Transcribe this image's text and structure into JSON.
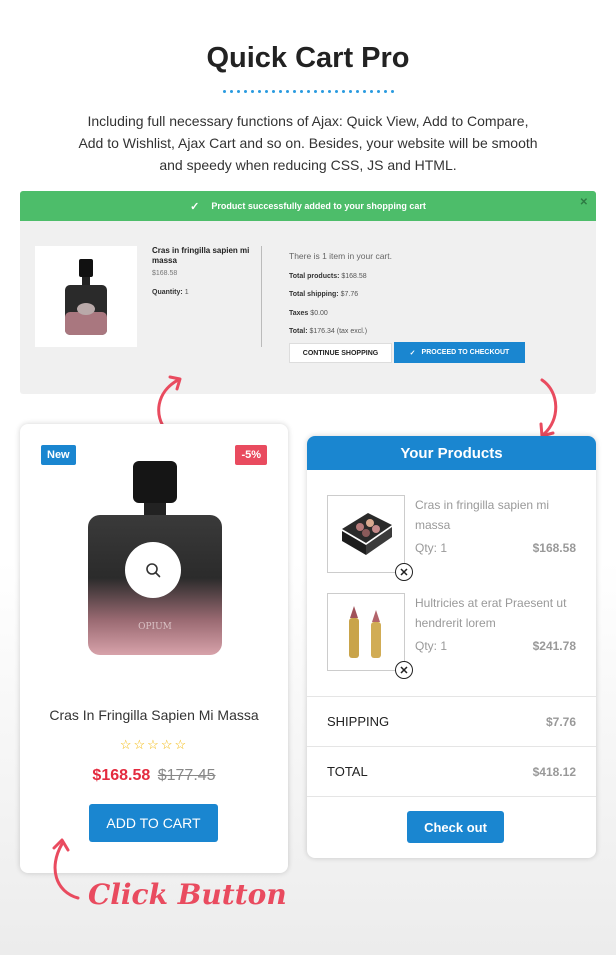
{
  "header": {
    "title": "Quick Cart Pro",
    "description_lines": [
      "Including full necessary functions of Ajax: Quick View, Add to Compare,",
      "Add to Wishlist, Ajax Cart and so on. Besides, your website will be smooth",
      "and speedy when reducing CSS, JS and HTML."
    ]
  },
  "notification": {
    "message": "Product successfully added to your shopping cart",
    "product_name": "Cras in fringilla sapien mi massa",
    "price": "$168.58",
    "quantity_label": "Quantity:",
    "quantity_value": "1",
    "cart_count_text": "There is 1 item in your cart.",
    "total_products_label": "Total products:",
    "total_products_value": "$168.58",
    "total_shipping_label": "Total shipping:",
    "total_shipping_value": "$7.76",
    "taxes_label": "Taxes",
    "taxes_value": "$0.00",
    "total_label": "Total:",
    "total_value": "$176.34 (tax excl.)",
    "continue_label": "CONTINUE SHOPPING",
    "proceed_label": "PROCEED TO CHECKOUT"
  },
  "product_card": {
    "badge_new": "New",
    "badge_discount": "-5%",
    "name": "Cras In Fringilla Sapien Mi Massa",
    "rating": 0,
    "rating_max": 5,
    "stars": "☆☆☆☆☆",
    "price": "$168.58",
    "old_price": "$177.45",
    "add_to_cart_label": "ADD TO CART",
    "bottle_label": "OPIUM"
  },
  "your_products": {
    "heading": "Your Products",
    "items": [
      {
        "name": "Cras in fringilla sapien mi massa",
        "qty": "Qty: 1",
        "price": "$168.58"
      },
      {
        "name": "Hultricies at erat Praesent ut hendrerit lorem",
        "qty": "Qty: 1",
        "price": "$241.78"
      }
    ],
    "shipping_label": "SHIPPING",
    "shipping_value": "$7.76",
    "total_label": "TOTAL",
    "total_value": "$418.12",
    "checkout_label": "Check out"
  },
  "annotation": {
    "click_label": "Click Button"
  },
  "colors": {
    "accent_blue": "#1a86d0",
    "success_green": "#4dbd6a",
    "sale_red": "#e42b3f",
    "annotation_pink": "#e94b5f"
  }
}
